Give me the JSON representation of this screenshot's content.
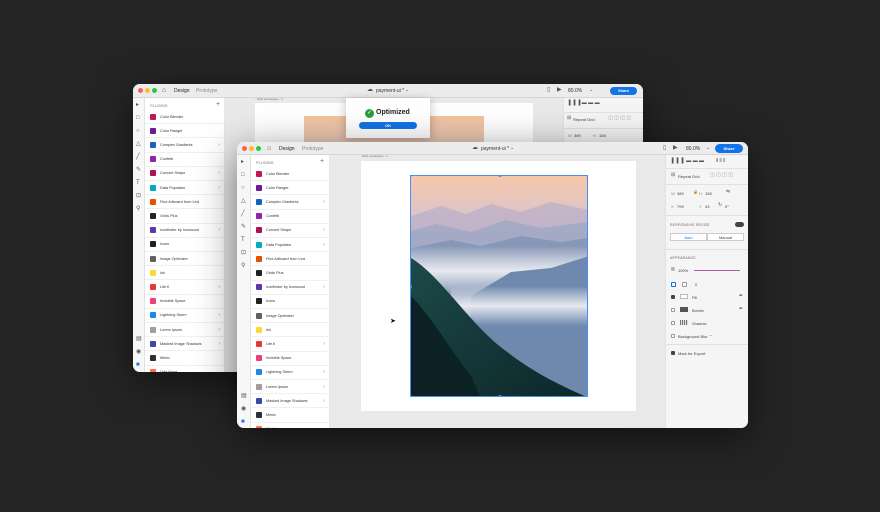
{
  "back_window": {
    "tabs": {
      "design": "Design",
      "prototype": "Prototype"
    },
    "doc_title": "payment-ui *",
    "zoom": "80.0%",
    "share": "Share",
    "panel_heading": "PLUGINS",
    "add": "+",
    "artboard_label": "iPad Landscape - 1",
    "dialog": {
      "status": "Optimized",
      "ok": "OK"
    },
    "prop_partial": {
      "repeat_grid": "Repeat Grid",
      "w": "W",
      "w_val": "389",
      "h": "H",
      "h_val": "158"
    }
  },
  "front_window": {
    "tabs": {
      "design": "Design",
      "prototype": "Prototype"
    },
    "doc_title": "payment-ui *",
    "zoom": "80.0%",
    "share": "Share",
    "panel_heading": "PLUGINS",
    "add": "+",
    "artboard_label": "iPad Landscape - 1",
    "props": {
      "repeat_grid": "Repeat Grid",
      "w_label": "W",
      "w": "389",
      "h_label": "H",
      "h": "158",
      "x_label": "X",
      "x": "799",
      "y_label": "Y",
      "y": "43",
      "rotation": "0°",
      "responsive_resize": "RESPONSIVE RESIZE",
      "auto": "Auto",
      "manual": "Manual",
      "appearance": "APPEARANCE",
      "opacity": "100%",
      "corner_radius": "0",
      "fill": "Fill",
      "border": "Border",
      "shadow": "Shadow",
      "background_blur": "Background Blur",
      "mark_for_export": "Mark for Export"
    }
  },
  "plugins": [
    {
      "name": "Color Blender",
      "color": "#c2185b",
      "more": false
    },
    {
      "name": "Color Ranger",
      "color": "#6a1b9a",
      "more": false
    },
    {
      "name": "Complex Gradients",
      "color": "#1565c0",
      "more": true
    },
    {
      "name": "Confetti",
      "color": "#8e24aa",
      "more": false
    },
    {
      "name": "Convert Shape",
      "color": "#ad1457",
      "more": true
    },
    {
      "name": "Data Populator",
      "color": "#00acc1",
      "more": true
    },
    {
      "name": "Find Artboard from Link",
      "color": "#e65100",
      "more": false
    },
    {
      "name": "Grids Plus",
      "color": "#222222",
      "more": false
    },
    {
      "name": "Iconfinder by Iconscout",
      "color": "#5e35b1",
      "more": true
    },
    {
      "name": "Icons",
      "color": "#212121",
      "more": false
    },
    {
      "name": "Image Optimizer",
      "color": "#616161",
      "more": false
    },
    {
      "name": "Ink",
      "color": "#fdd835",
      "more": false
    },
    {
      "name": "Lite.fi",
      "color": "#e53935",
      "more": true
    },
    {
      "name": "Invisible Space",
      "color": "#ec407a",
      "more": false
    },
    {
      "name": "Lightning Storm",
      "color": "#1e88e5",
      "more": true
    },
    {
      "name": "Lorem Ipsum",
      "color": "#9e9e9e",
      "more": true
    },
    {
      "name": "Masked Image Shadows",
      "color": "#3949ab",
      "more": true
    },
    {
      "name": "Mimic",
      "color": "#263238",
      "more": false
    },
    {
      "name": "Odd Hope",
      "color": "#ff7043",
      "more": false
    }
  ],
  "colors": {
    "accent": "#1473e6",
    "desktop_bg": "#252525",
    "border_swatch": "#555555",
    "range_bar": "#b05aa8"
  }
}
